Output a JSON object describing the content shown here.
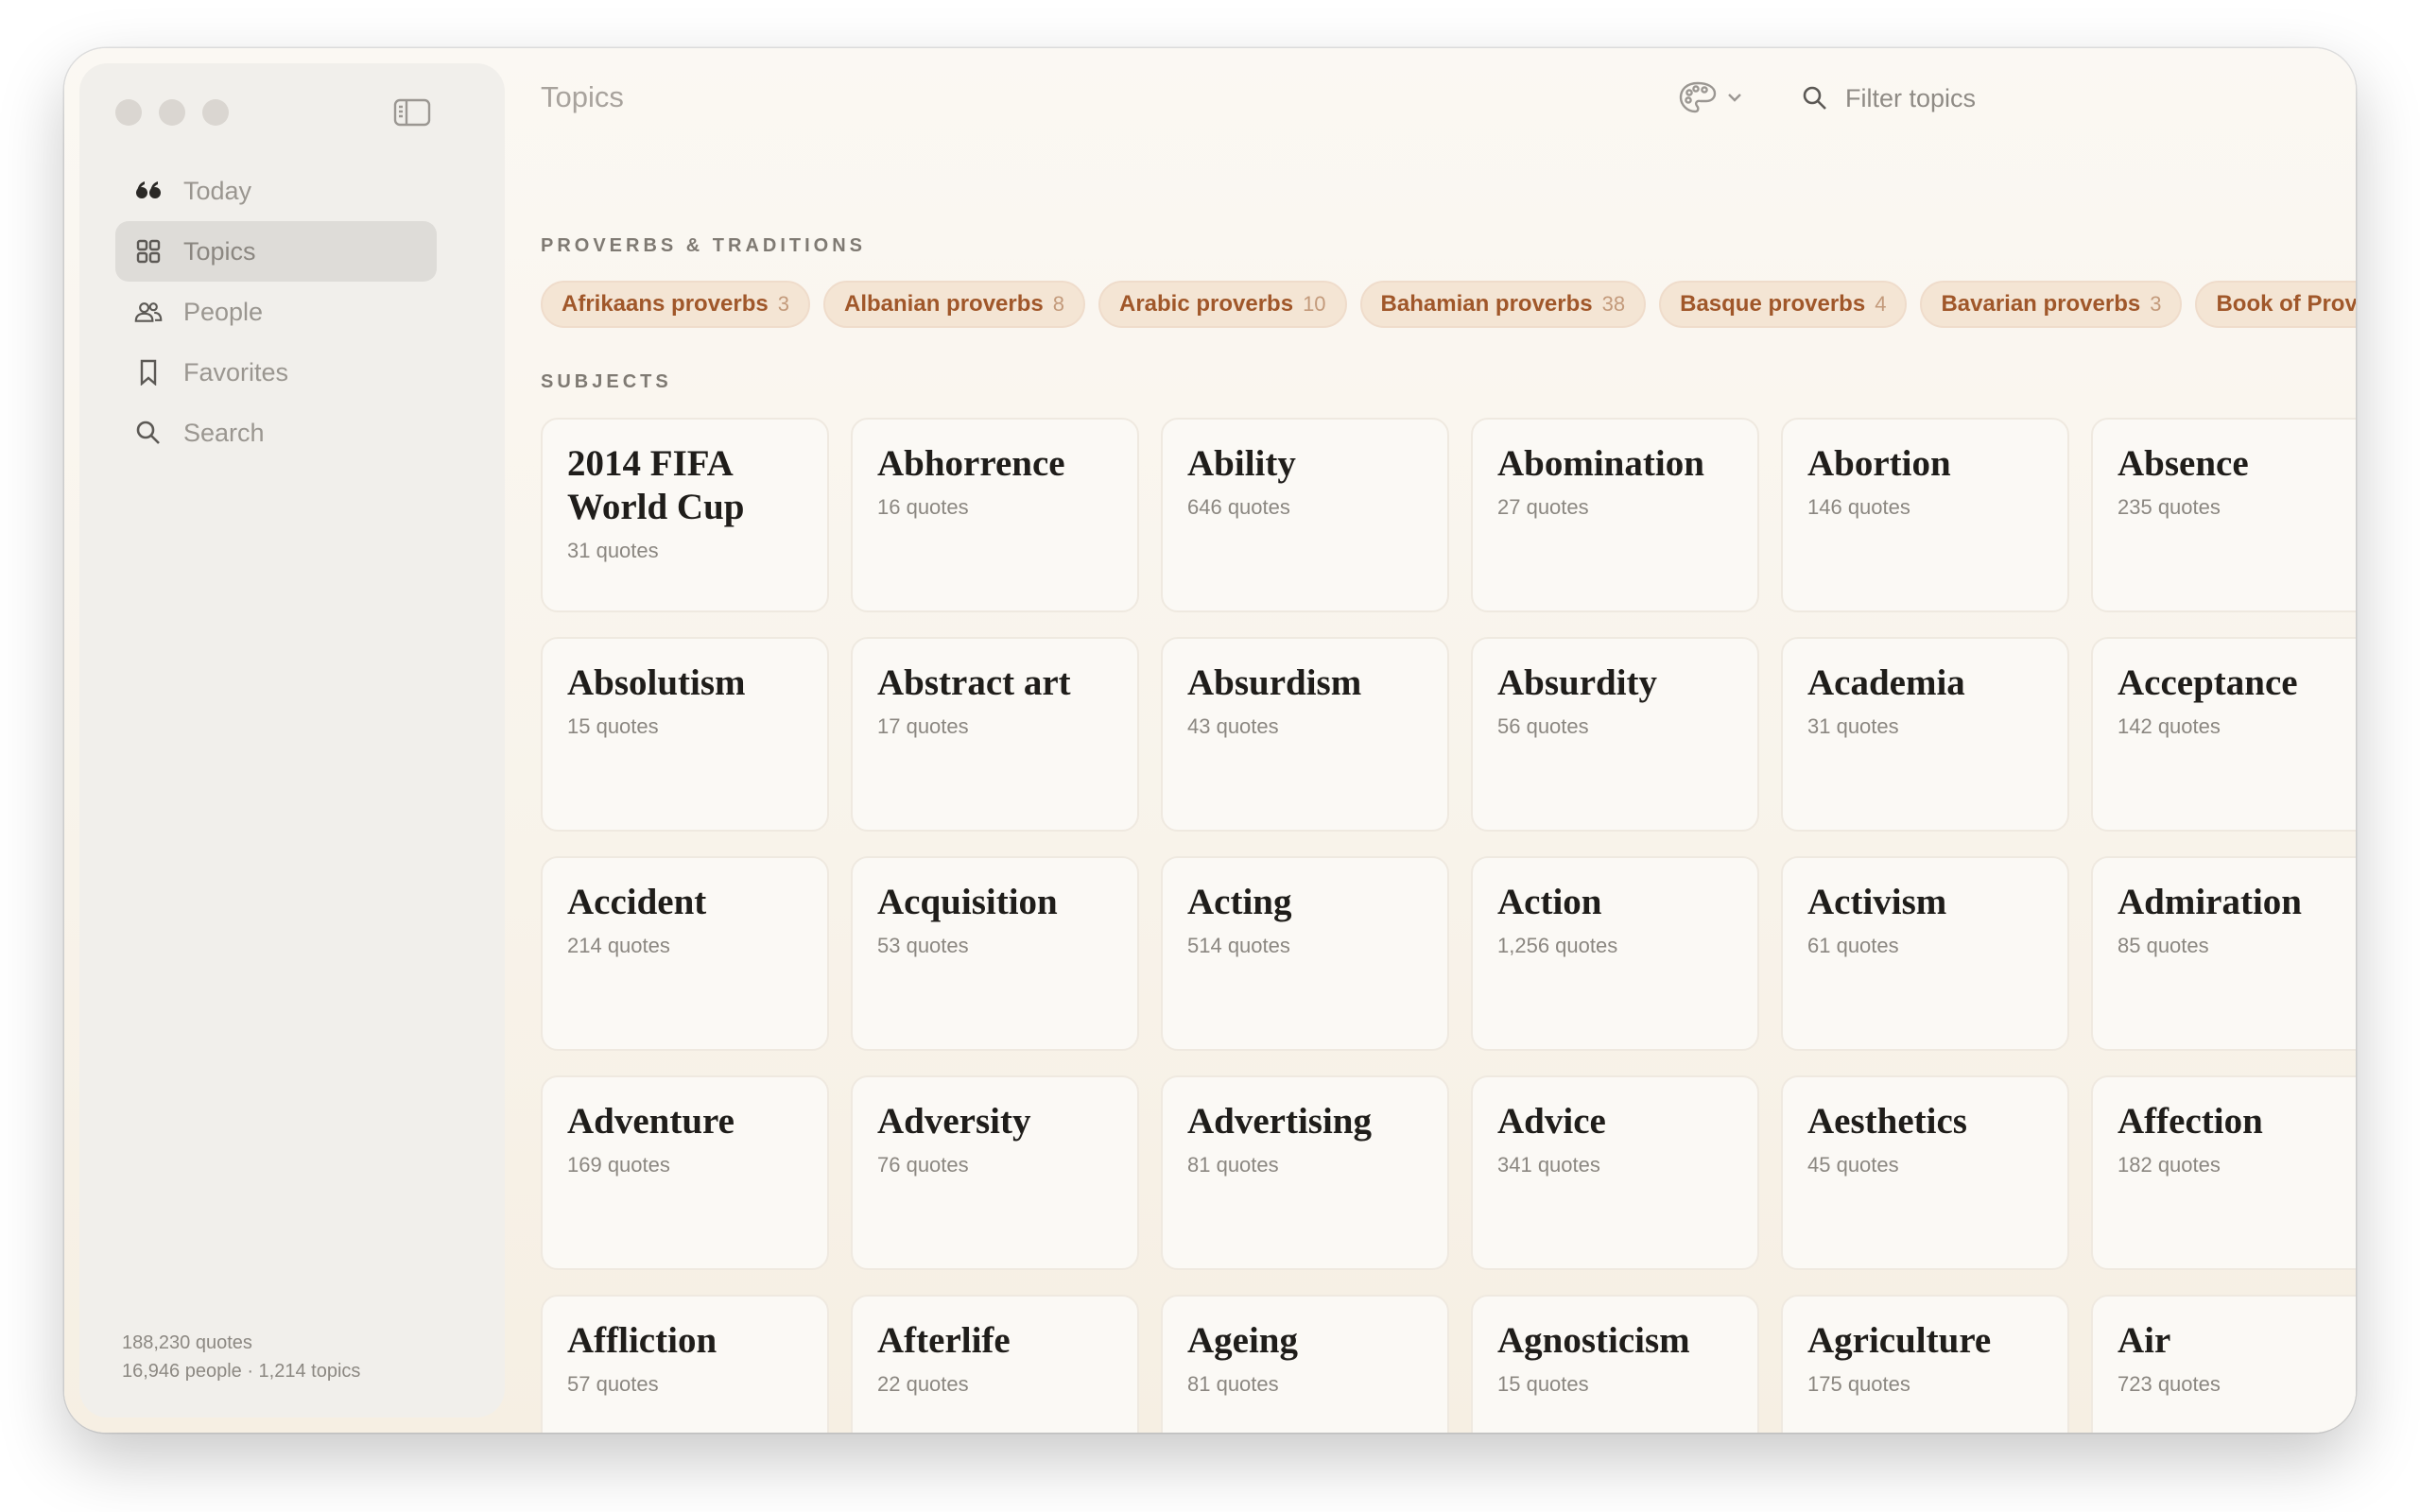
{
  "sidebar": {
    "nav": [
      {
        "label": "Today",
        "icon": "quote-icon"
      },
      {
        "label": "Topics",
        "icon": "grid-icon"
      },
      {
        "label": "People",
        "icon": "people-icon"
      },
      {
        "label": "Favorites",
        "icon": "bookmark-icon"
      },
      {
        "label": "Search",
        "icon": "search-icon"
      }
    ],
    "active": "Topics",
    "stats": {
      "line1": "188,230 quotes",
      "line2": "16,946 people · 1,214 topics"
    }
  },
  "header": {
    "title": "Topics",
    "filter_placeholder": "Filter topics"
  },
  "proverbs": {
    "label": "PROVERBS & TRADITIONS",
    "chips": [
      {
        "name": "Afrikaans proverbs",
        "count": "3"
      },
      {
        "name": "Albanian proverbs",
        "count": "8"
      },
      {
        "name": "Arabic proverbs",
        "count": "10"
      },
      {
        "name": "Bahamian proverbs",
        "count": "38"
      },
      {
        "name": "Basque proverbs",
        "count": "4"
      },
      {
        "name": "Bavarian proverbs",
        "count": "3"
      },
      {
        "name": "Book of Proverbs",
        "count": ""
      }
    ]
  },
  "subjects": {
    "label": "SUBJECTS",
    "cards": [
      {
        "title": "2014 FIFA World Cup",
        "count": "31 quotes"
      },
      {
        "title": "Abhorrence",
        "count": "16 quotes"
      },
      {
        "title": "Ability",
        "count": "646 quotes"
      },
      {
        "title": "Abomination",
        "count": "27 quotes"
      },
      {
        "title": "Abortion",
        "count": "146 quotes"
      },
      {
        "title": "Absence",
        "count": "235 quotes"
      },
      {
        "title": "Absolutism",
        "count": "15 quotes"
      },
      {
        "title": "Abstract art",
        "count": "17 quotes"
      },
      {
        "title": "Absurdism",
        "count": "43 quotes"
      },
      {
        "title": "Absurdity",
        "count": "56 quotes"
      },
      {
        "title": "Academia",
        "count": "31 quotes"
      },
      {
        "title": "Acceptance",
        "count": "142 quotes"
      },
      {
        "title": "Accident",
        "count": "214 quotes"
      },
      {
        "title": "Acquisition",
        "count": "53 quotes"
      },
      {
        "title": "Acting",
        "count": "514 quotes"
      },
      {
        "title": "Action",
        "count": "1,256 quotes"
      },
      {
        "title": "Activism",
        "count": "61 quotes"
      },
      {
        "title": "Admiration",
        "count": "85 quotes"
      },
      {
        "title": "Adventure",
        "count": "169 quotes"
      },
      {
        "title": "Adversity",
        "count": "76 quotes"
      },
      {
        "title": "Advertising",
        "count": "81 quotes"
      },
      {
        "title": "Advice",
        "count": "341 quotes"
      },
      {
        "title": "Aesthetics",
        "count": "45 quotes"
      },
      {
        "title": "Affection",
        "count": "182 quotes"
      },
      {
        "title": "Affliction",
        "count": "57 quotes"
      },
      {
        "title": "Afterlife",
        "count": "22 quotes"
      },
      {
        "title": "Ageing",
        "count": "81 quotes"
      },
      {
        "title": "Agnosticism",
        "count": "15 quotes"
      },
      {
        "title": "Agriculture",
        "count": "175 quotes"
      },
      {
        "title": "Air",
        "count": "723 quotes"
      }
    ]
  },
  "colors": {
    "accent": "#a0572a",
    "chip_bg": "#f4e5d4",
    "title": "#1f1d1a"
  }
}
